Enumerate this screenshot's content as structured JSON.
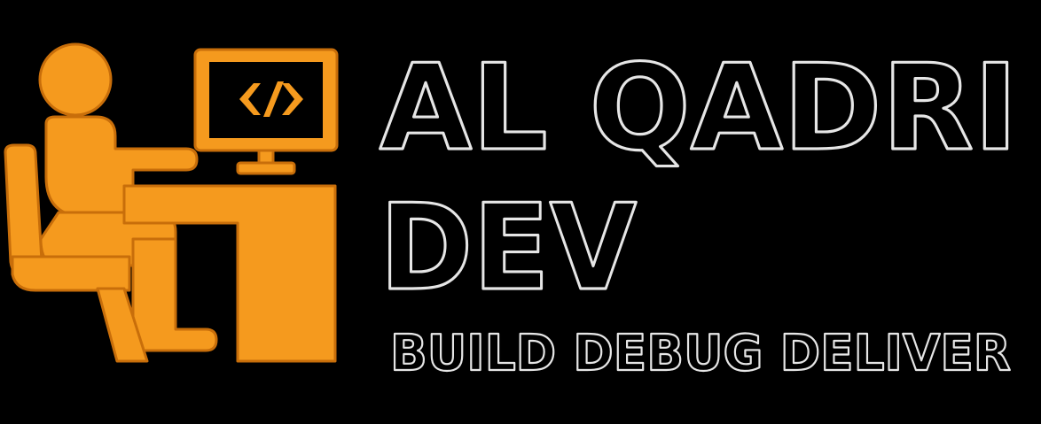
{
  "brand": {
    "name_line1": "AL QADRI",
    "name_line2": "DEV",
    "tagline": "BUILD DEBUG DELIVER",
    "code_glyph": "</>"
  },
  "icons": [
    "developer-at-desk-icon",
    "monitor-icon",
    "code-brackets-icon"
  ],
  "colors": {
    "background": "#000000",
    "accent": "#F59A1E",
    "accent_dark": "#C86E0A",
    "outline_text": "#E6E6E6"
  }
}
